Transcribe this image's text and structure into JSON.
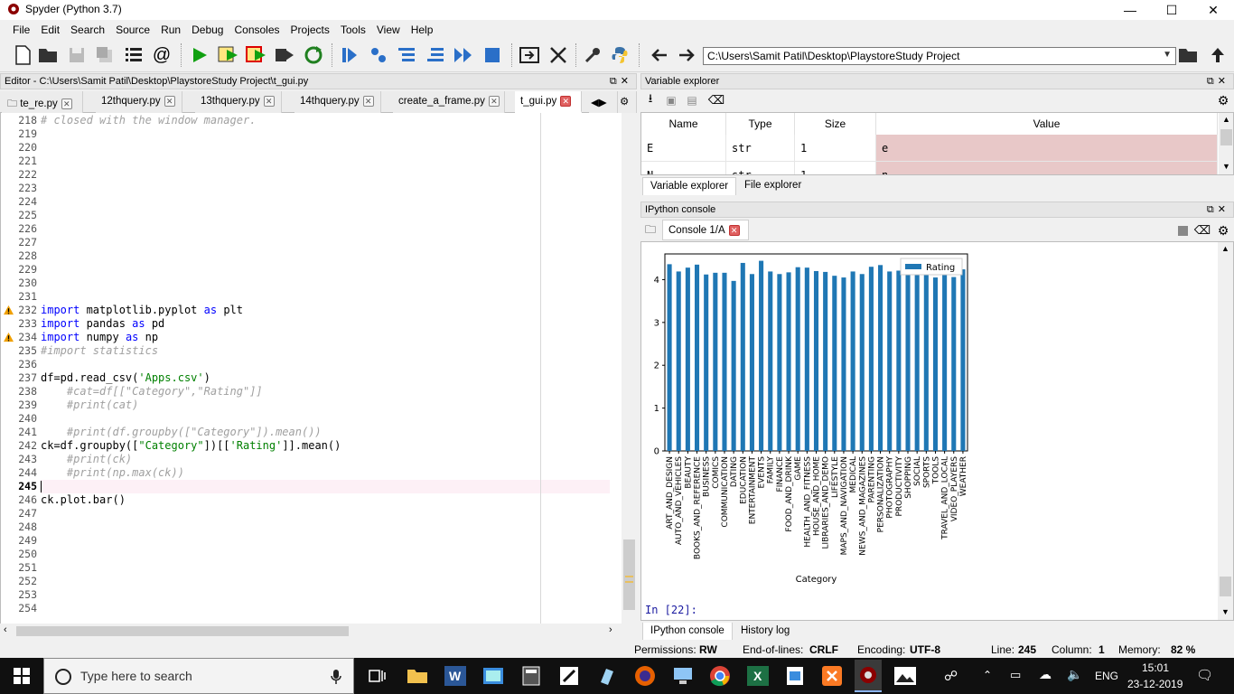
{
  "window": {
    "title": "Spyder (Python 3.7)",
    "minimize": "—",
    "maximize": "☐",
    "close": "✕"
  },
  "menu": [
    "File",
    "Edit",
    "Search",
    "Source",
    "Run",
    "Debug",
    "Consoles",
    "Projects",
    "Tools",
    "View",
    "Help"
  ],
  "toolbar": {
    "path": "C:\\Users\\Samit Patil\\Desktop\\PlaystoreStudy Project"
  },
  "editor": {
    "title": "Editor - C:\\Users\\Samit Patil\\Desktop\\PlaystoreStudy Project\\t_gui.py",
    "tabs": [
      "te_re.py",
      "12thquery.py",
      "13thquery.py",
      "14thquery.py",
      "create_a_frame.py",
      "t_gui.py"
    ],
    "active_tab": "t_gui.py",
    "current_line": "245",
    "lines": [
      {
        "n": "218",
        "t": "# closed with the window manager.",
        "k": "cm"
      },
      {
        "n": "219",
        "t": ""
      },
      {
        "n": "220",
        "t": ""
      },
      {
        "n": "221",
        "t": ""
      },
      {
        "n": "222",
        "t": ""
      },
      {
        "n": "223",
        "t": ""
      },
      {
        "n": "224",
        "t": ""
      },
      {
        "n": "225",
        "t": ""
      },
      {
        "n": "226",
        "t": ""
      },
      {
        "n": "227",
        "t": ""
      },
      {
        "n": "228",
        "t": ""
      },
      {
        "n": "229",
        "t": ""
      },
      {
        "n": "230",
        "t": ""
      },
      {
        "n": "231",
        "t": ""
      },
      {
        "n": "232",
        "t": "import matplotlib.pyplot as plt",
        "k": "imp",
        "warn": true
      },
      {
        "n": "233",
        "t": "import pandas as pd",
        "k": "imp"
      },
      {
        "n": "234",
        "t": "import numpy as np",
        "k": "imp",
        "warn": true
      },
      {
        "n": "235",
        "t": "#import statistics",
        "k": "cm"
      },
      {
        "n": "236",
        "t": ""
      },
      {
        "n": "237",
        "t": "df=pd.read_csv('Apps.csv')",
        "k": "csv"
      },
      {
        "n": "238",
        "t": "    #cat=df[[\"Category\",\"Rating\"]]",
        "k": "cm"
      },
      {
        "n": "239",
        "t": "    #print(cat)",
        "k": "cm"
      },
      {
        "n": "240",
        "t": ""
      },
      {
        "n": "241",
        "t": "    #print(df.groupby([\"Category\"]).mean())",
        "k": "cm"
      },
      {
        "n": "242",
        "t": "ck=df.groupby([\"Category\"])[['Rating']].mean()",
        "k": "grp"
      },
      {
        "n": "243",
        "t": "    #print(ck)",
        "k": "cm"
      },
      {
        "n": "244",
        "t": "    #print(np.max(ck))",
        "k": "cm"
      },
      {
        "n": "245",
        "t": ""
      },
      {
        "n": "246",
        "t": "ck.plot.bar()"
      },
      {
        "n": "247",
        "t": ""
      },
      {
        "n": "248",
        "t": ""
      },
      {
        "n": "249",
        "t": ""
      },
      {
        "n": "250",
        "t": ""
      },
      {
        "n": "251",
        "t": ""
      },
      {
        "n": "252",
        "t": ""
      },
      {
        "n": "253",
        "t": ""
      },
      {
        "n": "254",
        "t": ""
      }
    ]
  },
  "variable_explorer": {
    "title": "Variable explorer",
    "columns": [
      "Name",
      "Type",
      "Size",
      "Value"
    ],
    "rows": [
      {
        "name": "E",
        "type": "str",
        "size": "1",
        "value": "e"
      },
      {
        "name": "N",
        "type": "str",
        "size": "1",
        "value": "n"
      }
    ],
    "tabs": [
      "Variable explorer",
      "File explorer"
    ]
  },
  "console": {
    "title": "IPython console",
    "tab": "Console 1/A",
    "prompt": "In [22]:",
    "tabs": [
      "IPython console",
      "History log"
    ]
  },
  "chart_data": {
    "type": "bar",
    "xlabel": "Category",
    "ylabel": "",
    "ylim": [
      0,
      4.6
    ],
    "yticks": [
      0,
      1,
      2,
      3,
      4
    ],
    "legend": "top-right",
    "color": "#1f77b4",
    "categories": [
      "ART_AND_DESIGN",
      "AUTO_AND_VEHICLES",
      "BEAUTY",
      "BOOKS_AND_REFERENCE",
      "BUSINESS",
      "COMICS",
      "COMMUNICATION",
      "DATING",
      "EDUCATION",
      "ENTERTAINMENT",
      "EVENTS",
      "FAMILY",
      "FINANCE",
      "FOOD_AND_DRINK",
      "GAME",
      "HEALTH_AND_FITNESS",
      "HOUSE_AND_HOME",
      "LIBRARIES_AND_DEMO",
      "LIFESTYLE",
      "MAPS_AND_NAVIGATION",
      "MEDICAL",
      "NEWS_AND_MAGAZINES",
      "PARENTING",
      "PERSONALIZATION",
      "PHOTOGRAPHY",
      "PRODUCTIVITY",
      "SHOPPING",
      "SOCIAL",
      "SPORTS",
      "TOOLS",
      "TRAVEL_AND_LOCAL",
      "VIDEO_PLAYERS",
      "WEATHER"
    ],
    "series": [
      {
        "name": "Rating",
        "values": [
          4.36,
          4.19,
          4.28,
          4.35,
          4.12,
          4.16,
          4.16,
          3.97,
          4.39,
          4.13,
          4.44,
          4.19,
          4.13,
          4.17,
          4.29,
          4.28,
          4.2,
          4.18,
          4.09,
          4.05,
          4.19,
          4.13,
          4.3,
          4.34,
          4.19,
          4.21,
          4.26,
          4.26,
          4.22,
          4.05,
          4.11,
          4.06,
          4.24
        ]
      }
    ]
  },
  "status": {
    "permissions_label": "Permissions:",
    "permissions": "RW",
    "eol_label": "End-of-lines:",
    "eol": "CRLF",
    "encoding_label": "Encoding:",
    "encoding": "UTF-8",
    "line_label": "Line:",
    "line": "245",
    "column_label": "Column:",
    "column": "1",
    "memory_label": "Memory:",
    "memory": "82 %"
  },
  "taskbar": {
    "search_placeholder": "Type here to search",
    "lang": "ENG",
    "time": "15:01",
    "date": "23-12-2019"
  }
}
